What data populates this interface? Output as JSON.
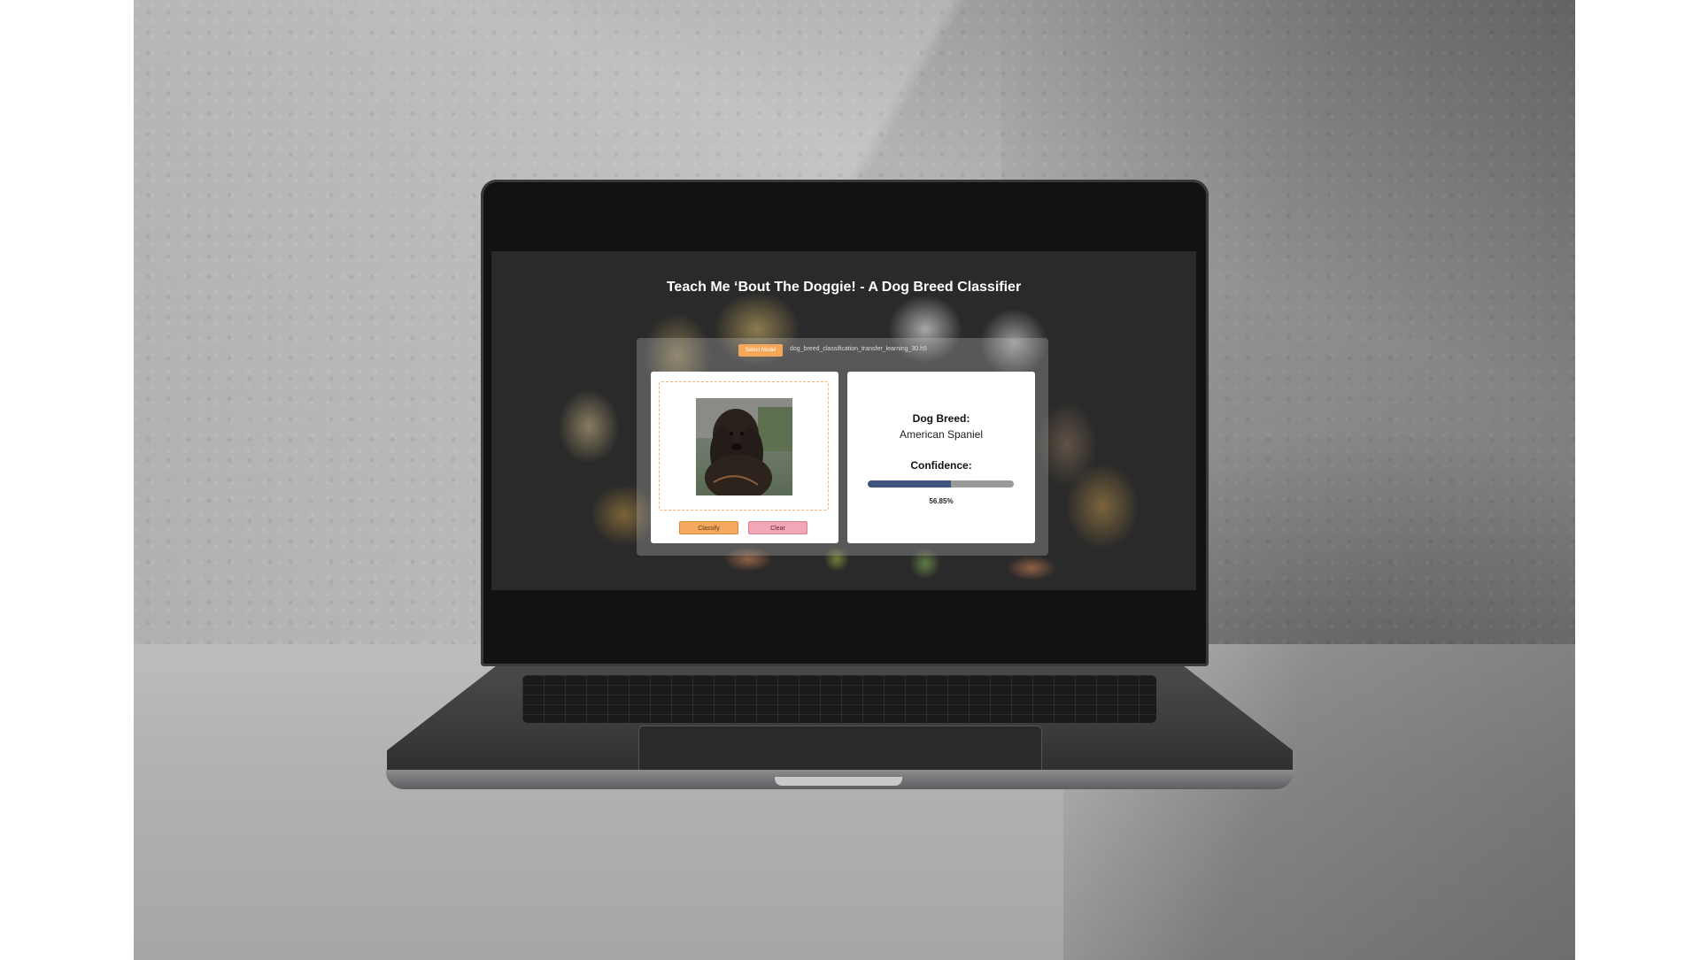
{
  "app": {
    "title": "Teach Me ‘Bout The Doggie! - A Dog Breed Classifier"
  },
  "model_selector": {
    "button_label": "Select Model",
    "selected_file": "dog_breed_classification_transfer_learning_30.h5"
  },
  "upload": {
    "image_subject": "dog-photo",
    "classify_label": "Classify",
    "clear_label": "Clear"
  },
  "result": {
    "breed_label": "Dog Breed:",
    "breed_value": "American Spaniel",
    "confidence_label": "Confidence:",
    "confidence_fraction": 0.5685,
    "confidence_text": "56.85%"
  },
  "colors": {
    "accent_orange": "#f5a95f",
    "clear_pink": "#f2a7b8",
    "confidence_bar": "#3e5380",
    "screen_bg": "#2a2a2a"
  }
}
